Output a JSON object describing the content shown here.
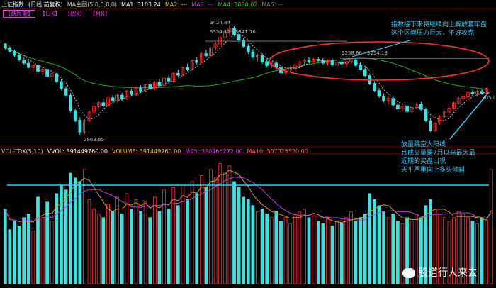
{
  "header": {
    "index_name": "上证指数",
    "period": "(日线 前复权)",
    "ma_label": "MA主图(5,0,0,0,0)",
    "ma1": "MA1: 3103.24",
    "ma2": "MA2: ---",
    "ma3": "MA3: ---",
    "ma4": "MA4: 3080.02",
    "ma5": "MA5: ---"
  },
  "buttons": [
    "【跌周期】",
    "【日K】",
    "【周K】",
    "【月K】"
  ],
  "volume_header": {
    "indicator": "VOL-TDX(5,10)",
    "vvol": "VVOL: 391449760.00",
    "volume": "VOLUME: 391449760.00",
    "ma5": "MA5: 320465272.00",
    "ma10": "MA10: 307025520.00"
  },
  "price_labels": {
    "high": "3424.84",
    "range_a": "3354.12 - 3341.16",
    "range_b": "3258.66 - 3254.18",
    "low": "2863.65",
    "right": "3050"
  },
  "annotations": {
    "top_note": [
      "指数接下来将继续向上解放套牢盘",
      "这个区间压力巨大，不好攻克"
    ],
    "bottom_note": [
      "放量跳空大阳线",
      "且成交量是7月以来最大最",
      "近期的买盘出现",
      "天平严重向上多头倾斜"
    ]
  },
  "watermark": "股道行人来去",
  "colors": {
    "up": "#ff3030",
    "down": "#40e0e0",
    "ma_green": "#22aa22",
    "ma_yellow": "#d0a020",
    "ma_white": "#e0e0e0",
    "ma_purple": "#c040e0",
    "note": "#33ccff",
    "ellipse": "#ff3030"
  },
  "chart_data": {
    "type": "candlestick",
    "price_range": [
      2830,
      3460
    ],
    "candles": [
      [
        3330,
        3335,
        3300,
        3310
      ],
      [
        3310,
        3318,
        3285,
        3292
      ],
      [
        3292,
        3300,
        3265,
        3272
      ],
      [
        3272,
        3280,
        3240,
        3248
      ],
      [
        3248,
        3260,
        3225,
        3232
      ],
      [
        3232,
        3245,
        3205,
        3210
      ],
      [
        3210,
        3228,
        3190,
        3220
      ],
      [
        3220,
        3230,
        3185,
        3190
      ],
      [
        3190,
        3210,
        3170,
        3200
      ],
      [
        3200,
        3205,
        3160,
        3165
      ],
      [
        3165,
        3185,
        3140,
        3178
      ],
      [
        3178,
        3182,
        3130,
        3138
      ],
      [
        3138,
        3150,
        3095,
        3102
      ],
      [
        3102,
        3115,
        3060,
        3068
      ],
      [
        3068,
        3080,
        2980,
        2990
      ],
      [
        2990,
        3000,
        2930,
        2940
      ],
      [
        2940,
        2955,
        2864,
        2880
      ],
      [
        2880,
        2945,
        2870,
        2938
      ],
      [
        2938,
        2990,
        2930,
        2982
      ],
      [
        2982,
        3020,
        2975,
        3010
      ],
      [
        3010,
        3040,
        2995,
        3030
      ],
      [
        3030,
        3050,
        3005,
        3015
      ],
      [
        3015,
        3060,
        3010,
        3055
      ],
      [
        3055,
        3070,
        3030,
        3040
      ],
      [
        3040,
        3075,
        3030,
        3068
      ],
      [
        3068,
        3080,
        3040,
        3050
      ],
      [
        3050,
        3095,
        3045,
        3090
      ],
      [
        3090,
        3100,
        3060,
        3072
      ],
      [
        3072,
        3110,
        3065,
        3105
      ],
      [
        3105,
        3120,
        3080,
        3090
      ],
      [
        3090,
        3128,
        3085,
        3122
      ],
      [
        3122,
        3130,
        3095,
        3100
      ],
      [
        3100,
        3140,
        3095,
        3135
      ],
      [
        3135,
        3150,
        3110,
        3118
      ],
      [
        3118,
        3160,
        3112,
        3155
      ],
      [
        3155,
        3170,
        3130,
        3140
      ],
      [
        3140,
        3185,
        3135,
        3180
      ],
      [
        3180,
        3200,
        3160,
        3170
      ],
      [
        3170,
        3215,
        3165,
        3210
      ],
      [
        3210,
        3230,
        3190,
        3200
      ],
      [
        3200,
        3250,
        3195,
        3245
      ],
      [
        3245,
        3265,
        3225,
        3235
      ],
      [
        3235,
        3285,
        3230,
        3280
      ],
      [
        3280,
        3300,
        3260,
        3270
      ],
      [
        3270,
        3315,
        3265,
        3310
      ],
      [
        3310,
        3340,
        3295,
        3330
      ],
      [
        3330,
        3370,
        3320,
        3362
      ],
      [
        3362,
        3400,
        3350,
        3392
      ],
      [
        3392,
        3424,
        3370,
        3410
      ],
      [
        3410,
        3420,
        3370,
        3378
      ],
      [
        3378,
        3395,
        3340,
        3350
      ],
      [
        3350,
        3362,
        3310,
        3318
      ],
      [
        3318,
        3330,
        3280,
        3290
      ],
      [
        3290,
        3305,
        3255,
        3262
      ],
      [
        3262,
        3280,
        3240,
        3272
      ],
      [
        3272,
        3282,
        3230,
        3240
      ],
      [
        3240,
        3255,
        3210,
        3220
      ],
      [
        3220,
        3240,
        3205,
        3232
      ],
      [
        3232,
        3245,
        3200,
        3210
      ],
      [
        3210,
        3222,
        3175,
        3182
      ],
      [
        3182,
        3205,
        3170,
        3198
      ],
      [
        3198,
        3215,
        3185,
        3208
      ],
      [
        3208,
        3230,
        3195,
        3222
      ],
      [
        3222,
        3245,
        3210,
        3238
      ],
      [
        3238,
        3255,
        3225,
        3248
      ],
      [
        3248,
        3262,
        3232,
        3240
      ],
      [
        3240,
        3258,
        3228,
        3252
      ],
      [
        3252,
        3265,
        3238,
        3245
      ],
      [
        3245,
        3258,
        3225,
        3232
      ],
      [
        3232,
        3250,
        3220,
        3245
      ],
      [
        3245,
        3256,
        3215,
        3222
      ],
      [
        3222,
        3240,
        3205,
        3235
      ],
      [
        3235,
        3250,
        3220,
        3228
      ],
      [
        3228,
        3245,
        3210,
        3240
      ],
      [
        3240,
        3258,
        3232,
        3250
      ],
      [
        3250,
        3255,
        3215,
        3220
      ],
      [
        3220,
        3235,
        3195,
        3200
      ],
      [
        3200,
        3212,
        3160,
        3168
      ],
      [
        3168,
        3180,
        3120,
        3128
      ],
      [
        3128,
        3140,
        3085,
        3092
      ],
      [
        3092,
        3105,
        3055,
        3062
      ],
      [
        3062,
        3078,
        3030,
        3040
      ],
      [
        3040,
        3060,
        3020,
        3052
      ],
      [
        3052,
        3065,
        3010,
        3018
      ],
      [
        3018,
        3030,
        2990,
        2998
      ],
      [
        2998,
        3020,
        2985,
        3012
      ],
      [
        3012,
        3025,
        2978,
        2985
      ],
      [
        2985,
        3010,
        2975,
        3005
      ],
      [
        3005,
        3030,
        2998,
        3022
      ],
      [
        3022,
        3035,
        2990,
        2996
      ],
      [
        2996,
        3005,
        2930,
        2938
      ],
      [
        2938,
        2950,
        2880,
        2888
      ],
      [
        2888,
        2930,
        2882,
        2925
      ],
      [
        2925,
        2965,
        2918,
        2958
      ],
      [
        2958,
        2990,
        2950,
        2982
      ],
      [
        2982,
        3010,
        2975,
        3002
      ],
      [
        3002,
        3035,
        2995,
        3028
      ],
      [
        3028,
        3060,
        3020,
        3052
      ],
      [
        3052,
        3075,
        3040,
        3060
      ],
      [
        3060,
        3090,
        3050,
        3082
      ],
      [
        3082,
        3095,
        3065,
        3075
      ],
      [
        3075,
        3095,
        3060,
        3088
      ],
      [
        3088,
        3100,
        3070,
        3078
      ],
      [
        3078,
        3105,
        3075,
        3103
      ]
    ],
    "volume": [
      0.62,
      0.45,
      0.52,
      0.48,
      0.55,
      0.58,
      0.44,
      0.72,
      0.55,
      0.68,
      0.52,
      0.75,
      0.82,
      0.78,
      0.92,
      0.88,
      0.85,
      0.95,
      0.7,
      0.62,
      0.58,
      0.55,
      0.66,
      0.6,
      0.72,
      0.58,
      0.75,
      0.62,
      0.7,
      0.6,
      0.68,
      0.55,
      0.72,
      0.6,
      0.78,
      0.62,
      0.8,
      0.65,
      0.82,
      0.7,
      0.85,
      0.75,
      0.9,
      0.8,
      0.95,
      0.88,
      1.0,
      0.92,
      0.98,
      0.85,
      0.8,
      0.72,
      0.7,
      0.65,
      0.6,
      0.62,
      0.58,
      0.55,
      0.6,
      0.52,
      0.55,
      0.5,
      0.58,
      0.6,
      0.62,
      0.55,
      0.58,
      0.52,
      0.5,
      0.55,
      0.48,
      0.52,
      0.5,
      0.55,
      0.6,
      0.52,
      0.55,
      0.58,
      0.75,
      0.7,
      0.65,
      0.6,
      0.55,
      0.58,
      0.52,
      0.5,
      0.55,
      0.52,
      0.58,
      0.55,
      0.65,
      0.7,
      0.62,
      0.58,
      0.55,
      0.52,
      0.55,
      0.6,
      0.58,
      0.55,
      0.52,
      0.5,
      0.55,
      0.53,
      0.95
    ]
  }
}
